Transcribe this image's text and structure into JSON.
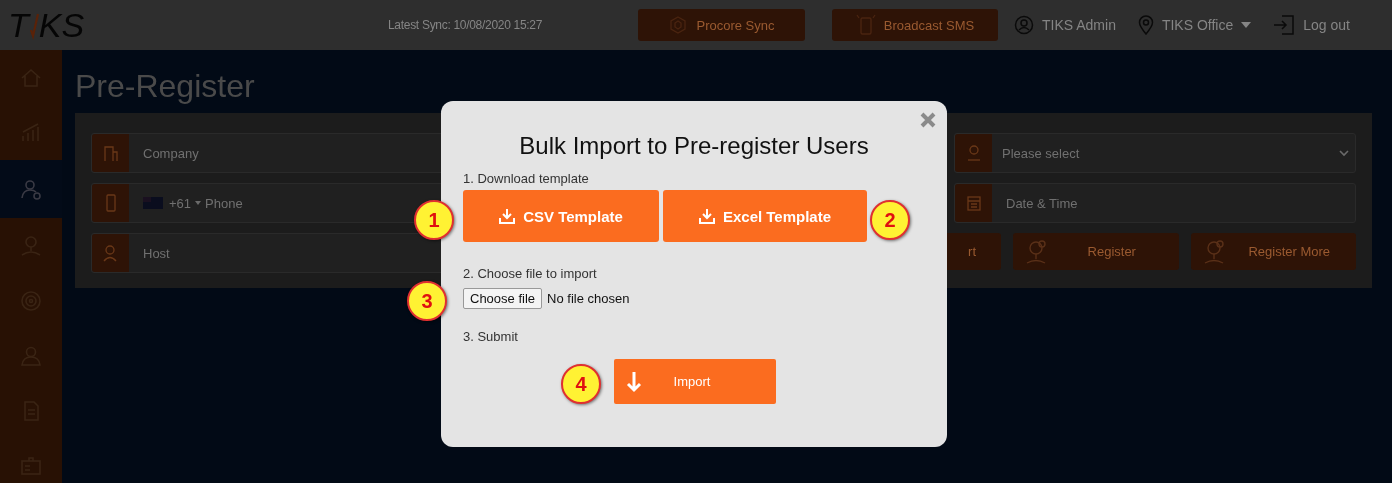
{
  "topbar": {
    "logo": [
      "T",
      "KS"
    ],
    "sync": "Latest Sync: 10/08/2020 15:27",
    "actions": [
      {
        "kind": "procore",
        "label": "Procore Sync"
      },
      {
        "kind": "sms",
        "label": "Broadcast SMS"
      }
    ],
    "user": "TIKS Admin",
    "office": "TIKS Office",
    "logout": "Log out"
  },
  "sidebar": {
    "items": [
      {
        "kind": "home",
        "selected": false
      },
      {
        "kind": "chart",
        "selected": false
      },
      {
        "kind": "user-add",
        "selected": true
      },
      {
        "kind": "pin-person",
        "selected": false
      },
      {
        "kind": "target",
        "selected": false
      },
      {
        "kind": "person",
        "selected": false
      },
      {
        "kind": "document",
        "selected": false
      },
      {
        "kind": "id-card",
        "selected": false
      }
    ]
  },
  "page": {
    "title": "Pre-Register",
    "left_fields": [
      {
        "kind": "company",
        "placeholder": "Company"
      },
      {
        "kind": "phone",
        "code": "+61",
        "placeholder": "Phone"
      },
      {
        "kind": "host",
        "placeholder": "Host"
      }
    ],
    "right_fields": [
      {
        "kind": "select",
        "value": "Please select"
      },
      {
        "kind": "date",
        "placeholder": "Date & Time"
      }
    ],
    "buttons": [
      {
        "kind": "partial",
        "label": "rt"
      },
      {
        "kind": "register",
        "label": "Register"
      },
      {
        "kind": "register",
        "label": "Register More"
      }
    ]
  },
  "modal": {
    "title": "Bulk Import to Pre-register Users",
    "step1": "1. Download template",
    "templates": [
      "CSV Template",
      "Excel Template"
    ],
    "step2": "2. Choose file to import",
    "choose": "Choose file",
    "no_file": "No file chosen",
    "step3": "3. Submit",
    "import": "Import"
  },
  "callouts": [
    {
      "kind": "csv",
      "label": "1"
    },
    {
      "kind": "excel",
      "label": "2"
    },
    {
      "kind": "file",
      "label": "3"
    },
    {
      "kind": "import",
      "label": "4"
    }
  ]
}
